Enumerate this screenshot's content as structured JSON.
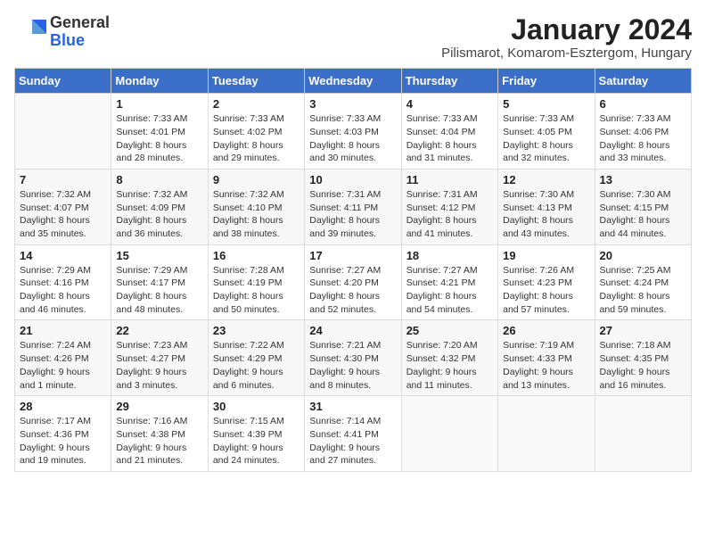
{
  "header": {
    "logo_general": "General",
    "logo_blue": "Blue",
    "month_title": "January 2024",
    "subtitle": "Pilismarot, Komarom-Esztergom, Hungary"
  },
  "weekdays": [
    "Sunday",
    "Monday",
    "Tuesday",
    "Wednesday",
    "Thursday",
    "Friday",
    "Saturday"
  ],
  "weeks": [
    [
      {
        "day": "",
        "detail": ""
      },
      {
        "day": "1",
        "detail": "Sunrise: 7:33 AM\nSunset: 4:01 PM\nDaylight: 8 hours\nand 28 minutes."
      },
      {
        "day": "2",
        "detail": "Sunrise: 7:33 AM\nSunset: 4:02 PM\nDaylight: 8 hours\nand 29 minutes."
      },
      {
        "day": "3",
        "detail": "Sunrise: 7:33 AM\nSunset: 4:03 PM\nDaylight: 8 hours\nand 30 minutes."
      },
      {
        "day": "4",
        "detail": "Sunrise: 7:33 AM\nSunset: 4:04 PM\nDaylight: 8 hours\nand 31 minutes."
      },
      {
        "day": "5",
        "detail": "Sunrise: 7:33 AM\nSunset: 4:05 PM\nDaylight: 8 hours\nand 32 minutes."
      },
      {
        "day": "6",
        "detail": "Sunrise: 7:33 AM\nSunset: 4:06 PM\nDaylight: 8 hours\nand 33 minutes."
      }
    ],
    [
      {
        "day": "7",
        "detail": "Sunrise: 7:32 AM\nSunset: 4:07 PM\nDaylight: 8 hours\nand 35 minutes."
      },
      {
        "day": "8",
        "detail": "Sunrise: 7:32 AM\nSunset: 4:09 PM\nDaylight: 8 hours\nand 36 minutes."
      },
      {
        "day": "9",
        "detail": "Sunrise: 7:32 AM\nSunset: 4:10 PM\nDaylight: 8 hours\nand 38 minutes."
      },
      {
        "day": "10",
        "detail": "Sunrise: 7:31 AM\nSunset: 4:11 PM\nDaylight: 8 hours\nand 39 minutes."
      },
      {
        "day": "11",
        "detail": "Sunrise: 7:31 AM\nSunset: 4:12 PM\nDaylight: 8 hours\nand 41 minutes."
      },
      {
        "day": "12",
        "detail": "Sunrise: 7:30 AM\nSunset: 4:13 PM\nDaylight: 8 hours\nand 43 minutes."
      },
      {
        "day": "13",
        "detail": "Sunrise: 7:30 AM\nSunset: 4:15 PM\nDaylight: 8 hours\nand 44 minutes."
      }
    ],
    [
      {
        "day": "14",
        "detail": "Sunrise: 7:29 AM\nSunset: 4:16 PM\nDaylight: 8 hours\nand 46 minutes."
      },
      {
        "day": "15",
        "detail": "Sunrise: 7:29 AM\nSunset: 4:17 PM\nDaylight: 8 hours\nand 48 minutes."
      },
      {
        "day": "16",
        "detail": "Sunrise: 7:28 AM\nSunset: 4:19 PM\nDaylight: 8 hours\nand 50 minutes."
      },
      {
        "day": "17",
        "detail": "Sunrise: 7:27 AM\nSunset: 4:20 PM\nDaylight: 8 hours\nand 52 minutes."
      },
      {
        "day": "18",
        "detail": "Sunrise: 7:27 AM\nSunset: 4:21 PM\nDaylight: 8 hours\nand 54 minutes."
      },
      {
        "day": "19",
        "detail": "Sunrise: 7:26 AM\nSunset: 4:23 PM\nDaylight: 8 hours\nand 57 minutes."
      },
      {
        "day": "20",
        "detail": "Sunrise: 7:25 AM\nSunset: 4:24 PM\nDaylight: 8 hours\nand 59 minutes."
      }
    ],
    [
      {
        "day": "21",
        "detail": "Sunrise: 7:24 AM\nSunset: 4:26 PM\nDaylight: 9 hours\nand 1 minute."
      },
      {
        "day": "22",
        "detail": "Sunrise: 7:23 AM\nSunset: 4:27 PM\nDaylight: 9 hours\nand 3 minutes."
      },
      {
        "day": "23",
        "detail": "Sunrise: 7:22 AM\nSunset: 4:29 PM\nDaylight: 9 hours\nand 6 minutes."
      },
      {
        "day": "24",
        "detail": "Sunrise: 7:21 AM\nSunset: 4:30 PM\nDaylight: 9 hours\nand 8 minutes."
      },
      {
        "day": "25",
        "detail": "Sunrise: 7:20 AM\nSunset: 4:32 PM\nDaylight: 9 hours\nand 11 minutes."
      },
      {
        "day": "26",
        "detail": "Sunrise: 7:19 AM\nSunset: 4:33 PM\nDaylight: 9 hours\nand 13 minutes."
      },
      {
        "day": "27",
        "detail": "Sunrise: 7:18 AM\nSunset: 4:35 PM\nDaylight: 9 hours\nand 16 minutes."
      }
    ],
    [
      {
        "day": "28",
        "detail": "Sunrise: 7:17 AM\nSunset: 4:36 PM\nDaylight: 9 hours\nand 19 minutes."
      },
      {
        "day": "29",
        "detail": "Sunrise: 7:16 AM\nSunset: 4:38 PM\nDaylight: 9 hours\nand 21 minutes."
      },
      {
        "day": "30",
        "detail": "Sunrise: 7:15 AM\nSunset: 4:39 PM\nDaylight: 9 hours\nand 24 minutes."
      },
      {
        "day": "31",
        "detail": "Sunrise: 7:14 AM\nSunset: 4:41 PM\nDaylight: 9 hours\nand 27 minutes."
      },
      {
        "day": "",
        "detail": ""
      },
      {
        "day": "",
        "detail": ""
      },
      {
        "day": "",
        "detail": ""
      }
    ]
  ]
}
